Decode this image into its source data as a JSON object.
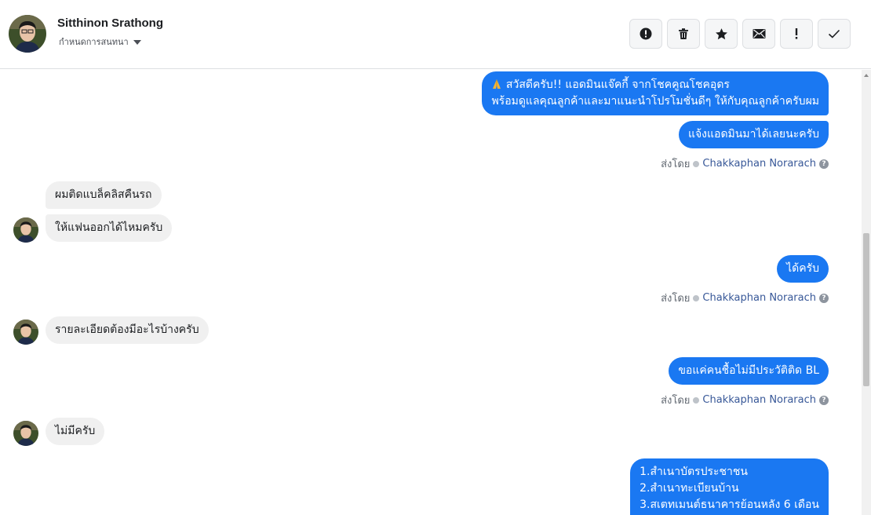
{
  "header": {
    "contact_name": "Sitthinon Srathong",
    "settings_label": "กำหนดการสนทนา",
    "actions": [
      {
        "name": "report-button",
        "icon": "alert-circle-icon"
      },
      {
        "name": "delete-button",
        "icon": "trash-icon"
      },
      {
        "name": "star-button",
        "icon": "star-icon"
      },
      {
        "name": "mail-button",
        "icon": "envelope-icon"
      },
      {
        "name": "mark-important-button",
        "icon": "exclamation-icon"
      },
      {
        "name": "mark-done-button",
        "icon": "checkmark-icon"
      }
    ]
  },
  "messages": {
    "m1_line1": "สวัสดีครับ!! แอดมินแจ๊คกี้ จากโชคคูณโชคอุดร",
    "m1_line2": "พร้อมดูแลคุณลูกค้าและมาแนะนำโปรโมชั่นดีๆ ให้กับคุณลูกค้าครับผม",
    "m2": "แจ้งแอดมินมาได้เลยนะครับ",
    "m3": "ผมติดแบล็คลิสคืนรถ",
    "m4": "ให้แฟนออกได้ไหมครับ",
    "m5": "ได้ครับ",
    "m6": "รายละเอียดต้องมีอะไรบ้างครับ",
    "m7": "ขอแค่คนชื้อไม่มีประวัติติด BL",
    "m8": "ไม่มีครับ",
    "m9_line1": "1.สำเนาบัตรประชาชน",
    "m9_line2": "2.สำเนาทะเบียนบ้าน",
    "m9_line3": "3.สเตทเมนต์ธนาคารย้อนหลัง 6 เดือน"
  },
  "sent_by": {
    "label": "ส่งโดย",
    "agent": "Chakkaphan Norarach",
    "help": "?"
  },
  "colors": {
    "outgoing_bubble": "#1a78f2",
    "incoming_bubble": "#f0f0f0",
    "agent_link": "#385898"
  }
}
